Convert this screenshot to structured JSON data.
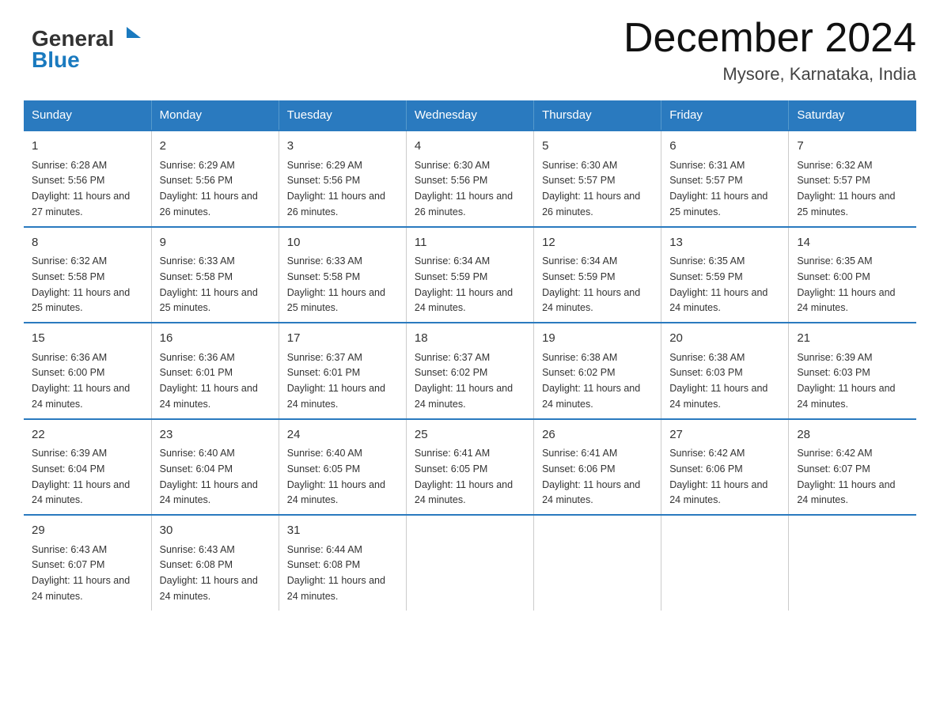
{
  "header": {
    "logo_line1": "General",
    "logo_line2": "Blue",
    "title": "December 2024",
    "subtitle": "Mysore, Karnataka, India"
  },
  "calendar": {
    "days_of_week": [
      "Sunday",
      "Monday",
      "Tuesday",
      "Wednesday",
      "Thursday",
      "Friday",
      "Saturday"
    ],
    "weeks": [
      [
        {
          "day": "1",
          "sunrise": "6:28 AM",
          "sunset": "5:56 PM",
          "daylight": "11 hours and 27 minutes."
        },
        {
          "day": "2",
          "sunrise": "6:29 AM",
          "sunset": "5:56 PM",
          "daylight": "11 hours and 26 minutes."
        },
        {
          "day": "3",
          "sunrise": "6:29 AM",
          "sunset": "5:56 PM",
          "daylight": "11 hours and 26 minutes."
        },
        {
          "day": "4",
          "sunrise": "6:30 AM",
          "sunset": "5:56 PM",
          "daylight": "11 hours and 26 minutes."
        },
        {
          "day": "5",
          "sunrise": "6:30 AM",
          "sunset": "5:57 PM",
          "daylight": "11 hours and 26 minutes."
        },
        {
          "day": "6",
          "sunrise": "6:31 AM",
          "sunset": "5:57 PM",
          "daylight": "11 hours and 25 minutes."
        },
        {
          "day": "7",
          "sunrise": "6:32 AM",
          "sunset": "5:57 PM",
          "daylight": "11 hours and 25 minutes."
        }
      ],
      [
        {
          "day": "8",
          "sunrise": "6:32 AM",
          "sunset": "5:58 PM",
          "daylight": "11 hours and 25 minutes."
        },
        {
          "day": "9",
          "sunrise": "6:33 AM",
          "sunset": "5:58 PM",
          "daylight": "11 hours and 25 minutes."
        },
        {
          "day": "10",
          "sunrise": "6:33 AM",
          "sunset": "5:58 PM",
          "daylight": "11 hours and 25 minutes."
        },
        {
          "day": "11",
          "sunrise": "6:34 AM",
          "sunset": "5:59 PM",
          "daylight": "11 hours and 24 minutes."
        },
        {
          "day": "12",
          "sunrise": "6:34 AM",
          "sunset": "5:59 PM",
          "daylight": "11 hours and 24 minutes."
        },
        {
          "day": "13",
          "sunrise": "6:35 AM",
          "sunset": "5:59 PM",
          "daylight": "11 hours and 24 minutes."
        },
        {
          "day": "14",
          "sunrise": "6:35 AM",
          "sunset": "6:00 PM",
          "daylight": "11 hours and 24 minutes."
        }
      ],
      [
        {
          "day": "15",
          "sunrise": "6:36 AM",
          "sunset": "6:00 PM",
          "daylight": "11 hours and 24 minutes."
        },
        {
          "day": "16",
          "sunrise": "6:36 AM",
          "sunset": "6:01 PM",
          "daylight": "11 hours and 24 minutes."
        },
        {
          "day": "17",
          "sunrise": "6:37 AM",
          "sunset": "6:01 PM",
          "daylight": "11 hours and 24 minutes."
        },
        {
          "day": "18",
          "sunrise": "6:37 AM",
          "sunset": "6:02 PM",
          "daylight": "11 hours and 24 minutes."
        },
        {
          "day": "19",
          "sunrise": "6:38 AM",
          "sunset": "6:02 PM",
          "daylight": "11 hours and 24 minutes."
        },
        {
          "day": "20",
          "sunrise": "6:38 AM",
          "sunset": "6:03 PM",
          "daylight": "11 hours and 24 minutes."
        },
        {
          "day": "21",
          "sunrise": "6:39 AM",
          "sunset": "6:03 PM",
          "daylight": "11 hours and 24 minutes."
        }
      ],
      [
        {
          "day": "22",
          "sunrise": "6:39 AM",
          "sunset": "6:04 PM",
          "daylight": "11 hours and 24 minutes."
        },
        {
          "day": "23",
          "sunrise": "6:40 AM",
          "sunset": "6:04 PM",
          "daylight": "11 hours and 24 minutes."
        },
        {
          "day": "24",
          "sunrise": "6:40 AM",
          "sunset": "6:05 PM",
          "daylight": "11 hours and 24 minutes."
        },
        {
          "day": "25",
          "sunrise": "6:41 AM",
          "sunset": "6:05 PM",
          "daylight": "11 hours and 24 minutes."
        },
        {
          "day": "26",
          "sunrise": "6:41 AM",
          "sunset": "6:06 PM",
          "daylight": "11 hours and 24 minutes."
        },
        {
          "day": "27",
          "sunrise": "6:42 AM",
          "sunset": "6:06 PM",
          "daylight": "11 hours and 24 minutes."
        },
        {
          "day": "28",
          "sunrise": "6:42 AM",
          "sunset": "6:07 PM",
          "daylight": "11 hours and 24 minutes."
        }
      ],
      [
        {
          "day": "29",
          "sunrise": "6:43 AM",
          "sunset": "6:07 PM",
          "daylight": "11 hours and 24 minutes."
        },
        {
          "day": "30",
          "sunrise": "6:43 AM",
          "sunset": "6:08 PM",
          "daylight": "11 hours and 24 minutes."
        },
        {
          "day": "31",
          "sunrise": "6:44 AM",
          "sunset": "6:08 PM",
          "daylight": "11 hours and 24 minutes."
        },
        null,
        null,
        null,
        null
      ]
    ]
  }
}
